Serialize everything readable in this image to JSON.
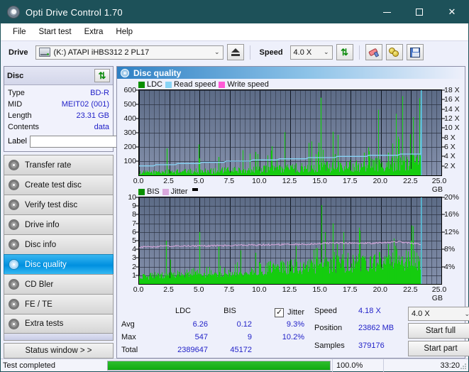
{
  "window": {
    "title": "Opti Drive Control 1.70",
    "app_icon": "disc-icon",
    "minimize": "–",
    "maximize": "□",
    "close": "✕"
  },
  "menu": {
    "items": [
      "File",
      "Start test",
      "Extra",
      "Help"
    ]
  },
  "toolbar": {
    "drive_label": "Drive",
    "drive_value": "(K:)   ATAPI iHBS312   2 PL17",
    "eject_title": "eject-button",
    "speed_label": "Speed",
    "speed_value": "4.0 X",
    "refresh_icon": "refresh-arrows-icon",
    "erase_icon": "eraser-icon",
    "coins_icon": "coins-icon",
    "save_icon": "floppy-save-icon"
  },
  "disc": {
    "header": "Disc",
    "refresh_icon": "refresh-arrows-icon",
    "rows": [
      {
        "key": "Type",
        "value": "BD-R"
      },
      {
        "key": "MID",
        "value": "MEIT02 (001)"
      },
      {
        "key": "Length",
        "value": "23.31 GB"
      },
      {
        "key": "Contents",
        "value": "data"
      }
    ],
    "label_key": "Label",
    "label_value": "",
    "label_placeholder": "",
    "label_button_icon": "cd-disc-icon"
  },
  "nav": {
    "items": [
      {
        "label": "Transfer rate",
        "active": false
      },
      {
        "label": "Create test disc",
        "active": false
      },
      {
        "label": "Verify test disc",
        "active": false
      },
      {
        "label": "Drive info",
        "active": false
      },
      {
        "label": "Disc info",
        "active": false
      },
      {
        "label": "Disc quality",
        "active": true
      },
      {
        "label": "CD Bler",
        "active": false
      },
      {
        "label": "FE / TE",
        "active": false
      },
      {
        "label": "Extra tests",
        "active": false
      }
    ],
    "status_window": "Status window > >"
  },
  "main": {
    "title": "Disc quality",
    "title_icon": "disc-quality-icon"
  },
  "chart_data": [
    {
      "id": "top-chart",
      "type": "bar",
      "title": "",
      "legend": [
        {
          "label": "LDC",
          "color": "#0a8f00"
        },
        {
          "label": "Read speed",
          "color": "#87d3f5"
        },
        {
          "label": "Write speed",
          "color": "#ff5ad6"
        }
      ],
      "legend_position": "top-left",
      "grid": true,
      "xlabel": "GB",
      "xlim": [
        0,
        25
      ],
      "xticks": [
        0.0,
        2.5,
        5.0,
        7.5,
        10.0,
        12.5,
        15.0,
        17.5,
        20.0,
        22.5,
        25.0
      ],
      "xticklabels": [
        "0.0",
        "2.5",
        "5.0",
        "7.5",
        "10.0",
        "12.5",
        "15.0",
        "17.5",
        "20.0",
        "22.5",
        "25.0 GB"
      ],
      "ylabel": "LDC",
      "ylim": [
        0,
        600
      ],
      "yticks": [
        100,
        200,
        300,
        400,
        500,
        600
      ],
      "yticklabels": [
        "100",
        "200",
        "300",
        "400",
        "500",
        "600"
      ],
      "y2label": "Speed",
      "y2lim": [
        0,
        18
      ],
      "y2ticks": [
        2,
        4,
        6,
        8,
        10,
        12,
        14,
        16,
        18
      ],
      "y2ticklabels": [
        "2 X",
        "4 X",
        "6 X",
        "8 X",
        "10 X",
        "12 X",
        "14 X",
        "16 X",
        "18 X"
      ],
      "series": [
        {
          "name": "LDC",
          "color": "#15cc0f",
          "type": "impulse",
          "note": "dense green error spikes across 0-23.3 GB, baseline ~20-60, notable peaks",
          "peaks": [
            {
              "x": 2.3,
              "y": 190
            },
            {
              "x": 4.95,
              "y": 218
            },
            {
              "x": 5.0,
              "y": 120
            },
            {
              "x": 6.6,
              "y": 130
            },
            {
              "x": 9.6,
              "y": 165
            },
            {
              "x": 9.8,
              "y": 150
            },
            {
              "x": 10.9,
              "y": 175
            },
            {
              "x": 11.0,
              "y": 205
            },
            {
              "x": 14.6,
              "y": 150
            },
            {
              "x": 14.85,
              "y": 230
            },
            {
              "x": 15.05,
              "y": 547
            },
            {
              "x": 15.2,
              "y": 180
            },
            {
              "x": 16.0,
              "y": 305
            },
            {
              "x": 16.2,
              "y": 150
            },
            {
              "x": 18.6,
              "y": 160
            },
            {
              "x": 19.0,
              "y": 170
            },
            {
              "x": 20.6,
              "y": 160
            },
            {
              "x": 21.5,
              "y": 255
            },
            {
              "x": 22.4,
              "y": 290
            }
          ]
        },
        {
          "name": "Read speed",
          "color": "#87d3f5",
          "type": "line",
          "points": [
            {
              "x": 0.0,
              "y": 2.0
            },
            {
              "x": 1.2,
              "y": 2.0
            },
            {
              "x": 1.4,
              "y": 2.25
            },
            {
              "x": 3.0,
              "y": 2.25
            },
            {
              "x": 3.2,
              "y": 2.5
            },
            {
              "x": 5.0,
              "y": 2.5
            },
            {
              "x": 5.2,
              "y": 2.75
            },
            {
              "x": 7.0,
              "y": 2.75
            },
            {
              "x": 7.2,
              "y": 3.0
            },
            {
              "x": 9.2,
              "y": 3.0
            },
            {
              "x": 9.4,
              "y": 3.25
            },
            {
              "x": 11.4,
              "y": 3.25
            },
            {
              "x": 11.6,
              "y": 3.5
            },
            {
              "x": 13.8,
              "y": 3.5
            },
            {
              "x": 14.0,
              "y": 3.75
            },
            {
              "x": 16.2,
              "y": 3.75
            },
            {
              "x": 16.4,
              "y": 4.0
            },
            {
              "x": 18.8,
              "y": 4.0
            },
            {
              "x": 19.0,
              "y": 4.25
            },
            {
              "x": 21.4,
              "y": 4.25
            },
            {
              "x": 21.6,
              "y": 4.5
            },
            {
              "x": 23.3,
              "y": 4.5
            },
            {
              "x": 23.35,
              "y": 18.0
            }
          ]
        },
        {
          "name": "Write speed",
          "color": "#ff5ad6",
          "type": "line",
          "points": []
        }
      ],
      "end_marker": {
        "x": 23.35,
        "color": "#5fd8f5",
        "label": "end-of-scan"
      }
    },
    {
      "id": "bottom-chart",
      "type": "bar",
      "title": "",
      "legend": [
        {
          "label": "BIS",
          "color": "#0a8f00"
        },
        {
          "label": "Jitter",
          "color": "#d9a8dd"
        }
      ],
      "legend_position": "top-left",
      "grid": true,
      "xlabel": "GB",
      "xlim": [
        0,
        25
      ],
      "xticks": [
        0.0,
        2.5,
        5.0,
        7.5,
        10.0,
        12.5,
        15.0,
        17.5,
        20.0,
        22.5,
        25.0
      ],
      "xticklabels": [
        "0.0",
        "2.5",
        "5.0",
        "7.5",
        "10.0",
        "12.5",
        "15.0",
        "17.5",
        "20.0",
        "22.5",
        "25.0 GB"
      ],
      "ylabel": "BIS",
      "ylim": [
        0,
        10
      ],
      "yticks": [
        1,
        2,
        3,
        4,
        5,
        6,
        7,
        8,
        9,
        10
      ],
      "yticklabels": [
        "1",
        "2",
        "3",
        "4",
        "5",
        "6",
        "7",
        "8",
        "9",
        "10"
      ],
      "y2label": "Jitter",
      "y2lim": [
        0,
        20
      ],
      "y2ticks": [
        4,
        8,
        12,
        16,
        20
      ],
      "y2ticklabels": [
        "4%",
        "8%",
        "12%",
        "16%",
        "20%"
      ],
      "series": [
        {
          "name": "BIS",
          "color": "#15cc0f",
          "type": "impulse",
          "note": "dense green bars, baseline ~1 rising to ~3 toward outer radius",
          "peaks": [
            {
              "x": 2.25,
              "y": 5.0
            },
            {
              "x": 5.0,
              "y": 6.0
            },
            {
              "x": 6.6,
              "y": 4.3
            },
            {
              "x": 9.6,
              "y": 3.6
            },
            {
              "x": 15.1,
              "y": 9.1
            },
            {
              "x": 16.0,
              "y": 7.0
            },
            {
              "x": 16.4,
              "y": 4.6
            },
            {
              "x": 20.6,
              "y": 4.6
            },
            {
              "x": 21.2,
              "y": 4.4
            },
            {
              "x": 22.5,
              "y": 5.0
            }
          ]
        },
        {
          "name": "Jitter",
          "color": "#d9a8dd",
          "type": "line",
          "note": "noisy trace ~8.5% rising gently to ~9.7%",
          "points": [
            {
              "x": 0.0,
              "y": 8.5
            },
            {
              "x": 2.0,
              "y": 8.7
            },
            {
              "x": 5.0,
              "y": 8.8
            },
            {
              "x": 8.0,
              "y": 8.9
            },
            {
              "x": 11.0,
              "y": 9.1
            },
            {
              "x": 14.0,
              "y": 9.2
            },
            {
              "x": 16.0,
              "y": 9.5
            },
            {
              "x": 19.0,
              "y": 9.4
            },
            {
              "x": 21.5,
              "y": 9.7
            },
            {
              "x": 23.3,
              "y": 9.2
            }
          ]
        }
      ],
      "end_marker": {
        "x": 23.35,
        "color": "#5fd8f5",
        "label": "end-of-scan"
      }
    }
  ],
  "stats": {
    "headers": {
      "ldc": "LDC",
      "bis": "BIS",
      "jitter": "Jitter"
    },
    "row_labels": {
      "avg": "Avg",
      "max": "Max",
      "total": "Total"
    },
    "ldc": {
      "avg": "6.26",
      "max": "547",
      "total": "2389647"
    },
    "bis": {
      "avg": "0.12",
      "max": "9",
      "total": "45172"
    },
    "jitter": {
      "avg": "9.3%",
      "max": "10.2%",
      "checked": true,
      "check_glyph": "✓"
    },
    "speed_label": "Speed",
    "speed_value": "4.18 X",
    "position_label": "Position",
    "position_value": "23862 MB",
    "samples_label": "Samples",
    "samples_value": "379176",
    "speed_select": "4.0 X",
    "start_full": "Start full",
    "start_part": "Start part"
  },
  "statusbar": {
    "message": "Test completed",
    "progress_percent": 100,
    "progress_text": "100.0%",
    "elapsed": "33:20"
  }
}
